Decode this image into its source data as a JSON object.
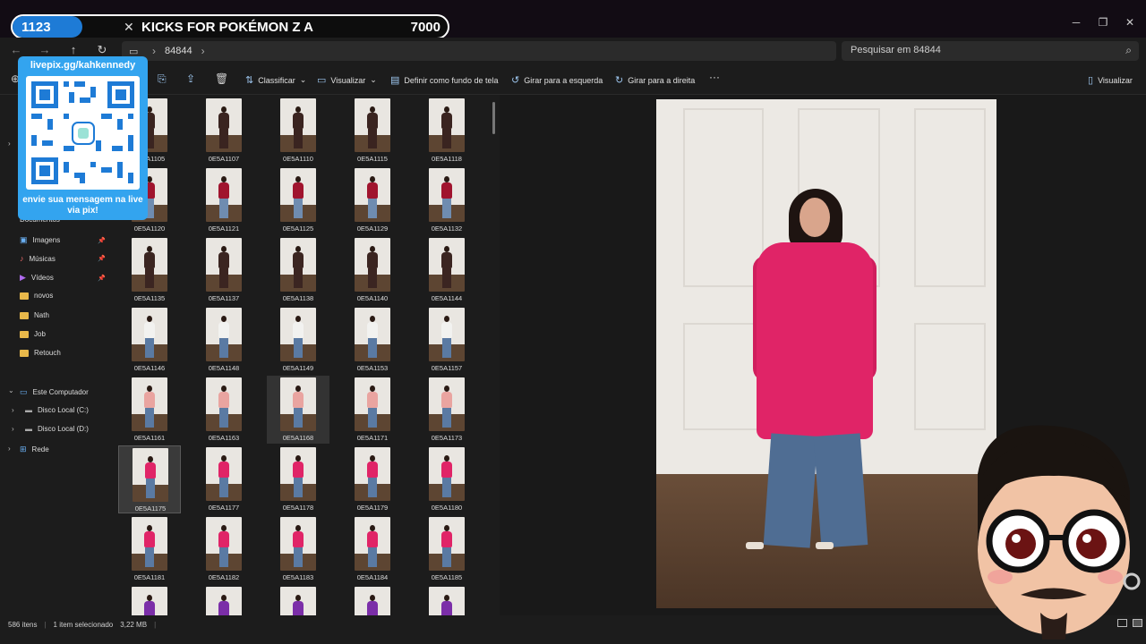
{
  "overlay": {
    "goal_count": "1123",
    "goal_title": "KICKS FOR POKÉMON Z A",
    "goal_target": "7000",
    "goal_progress": 0.16,
    "qr_url": "livepix.gg/kahkennedy",
    "qr_message": "envie sua mensagem na live via pix!"
  },
  "addressbar": {
    "breadcrumb": "84844",
    "search_placeholder": "Pesquisar em 84844"
  },
  "toolbar": {
    "sort": "Classificar",
    "view": "Visualizar",
    "set_wallpaper": "Definir como fundo de tela",
    "rotate_left": "Girar para a esquerda",
    "rotate_right": "Girar para a direita",
    "preview": "Visualizar"
  },
  "sidebar": {
    "documents": "Documentos",
    "images": "Imagens",
    "music": "Músicas",
    "videos": "Vídeos",
    "novos": "novos",
    "nath": "Nath",
    "job": "Job",
    "retouch": "Retouch",
    "this_pc": "Este Computador",
    "disk_c": "Disco Local (C:)",
    "disk_d": "Disco Local (D:)",
    "network": "Rede"
  },
  "files": [
    [
      "0E5A1105",
      "0E5A1107",
      "0E5A1110",
      "0E5A1115",
      "0E5A1118"
    ],
    [
      "0E5A1120",
      "0E5A1121",
      "0E5A1125",
      "0E5A1129",
      "0E5A1132"
    ],
    [
      "0E5A1135",
      "0E5A1137",
      "0E5A1138",
      "0E5A1140",
      "0E5A1144"
    ],
    [
      "0E5A1146",
      "0E5A1148",
      "0E5A1149",
      "0E5A1153",
      "0E5A1157"
    ],
    [
      "0E5A1161",
      "0E5A1163",
      "0E5A1168",
      "0E5A1171",
      "0E5A1173"
    ],
    [
      "0E5A1175",
      "0E5A1177",
      "0E5A1178",
      "0E5A1179",
      "0E5A1180"
    ],
    [
      "0E5A1181",
      "0E5A1182",
      "0E5A1183",
      "0E5A1184",
      "0E5A1185"
    ],
    [
      "",
      "",
      "",
      "",
      ""
    ]
  ],
  "row_outfit_colors": [
    "#3a2420",
    "#a0142e",
    "#3b2521",
    "#f2f2f0",
    "#e9a4a0",
    "#e02467",
    "#e02467",
    "#7b2ea8"
  ],
  "row_legs_colors": [
    "#3a2420",
    "#6f8cb0",
    "#3b2521",
    "#5a7aa3",
    "#5a7aa3",
    "#5a7aa3",
    "#5a7aa3",
    "#7b2ea8"
  ],
  "selected_file": "0E5A1175",
  "hovered_file": "0E5A1168",
  "status": {
    "items": "586 itens",
    "selected": "1 item selecionado",
    "size": "3,22 MB"
  },
  "colors": {
    "accent": "#1e7bd6",
    "qr_bg": "#33a4ef",
    "coat": "#e02467"
  }
}
